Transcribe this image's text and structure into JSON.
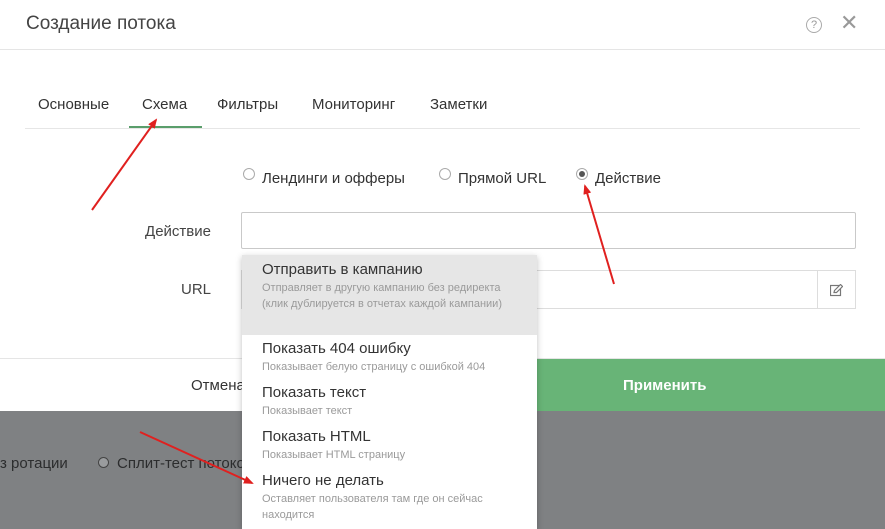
{
  "modal": {
    "title": "Создание потока",
    "help_icon": "?",
    "close_icon": "✕"
  },
  "tabs": [
    {
      "label": "Основные"
    },
    {
      "label": "Схема",
      "active": true
    },
    {
      "label": "Фильтры"
    },
    {
      "label": "Мониторинг"
    },
    {
      "label": "Заметки"
    }
  ],
  "scheme_options": [
    {
      "label": "Лендинги и офферы",
      "checked": false
    },
    {
      "label": "Прямой URL",
      "checked": false
    },
    {
      "label": "Действие",
      "checked": true
    }
  ],
  "form": {
    "action_label": "Действие",
    "action_value": "",
    "url_label": "URL",
    "url_value": ""
  },
  "footer": {
    "cancel_label": "Отмена",
    "apply_label": "Применить"
  },
  "dropdown": [
    {
      "title": "Отправить в кампанию",
      "desc": "Отправляет в другую кампанию без редиректа (клик дублируется в отчетах каждой кампании)"
    },
    {
      "title": "Показать 404 ошибку",
      "desc": "Показывает белую страницу с ошибкой 404"
    },
    {
      "title": "Показать текст",
      "desc": "Показывает текст"
    },
    {
      "title": "Показать HTML",
      "desc": "Показывает HTML страницу"
    },
    {
      "title": "Ничего не делать",
      "desc": "Оставляет пользователя там где он сейчас находится"
    }
  ],
  "background": {
    "rotation_text": "з ротации",
    "split_test_text": "Сплит-тест потоков"
  },
  "colors": {
    "accent_green": "#68b477",
    "tab_underline": "#5a9e6b",
    "annotation_arrow": "#e0201f"
  }
}
